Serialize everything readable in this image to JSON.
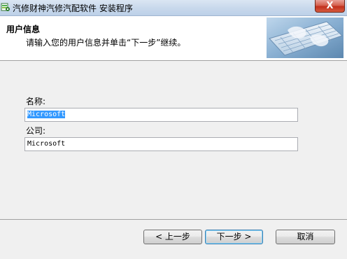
{
  "window": {
    "title": "汽修财神汽修汽配软件 安装程序",
    "close_label": "X"
  },
  "header": {
    "title": "用户信息",
    "subtitle": "请输入您的用户信息并单击“下一步”继续。",
    "image_icon": "keyboard-hands-image"
  },
  "form": {
    "name_label": "名称:",
    "name_value": "Microsoft",
    "company_label": "公司:",
    "company_value": "Microsoft"
  },
  "buttons": {
    "back": "< 上一步",
    "next": "下一步 >",
    "cancel": "取消"
  },
  "colors": {
    "selection": "#3399ff",
    "close_button": "#c2301c"
  }
}
